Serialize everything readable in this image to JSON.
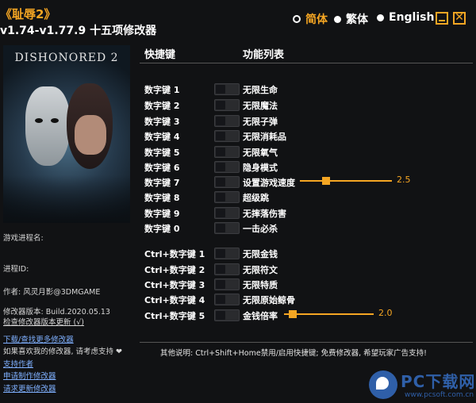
{
  "header": {
    "game_title": "《耻辱2》",
    "version_line": "v1.74-v1.77.9 十五项修改器"
  },
  "languages": [
    {
      "label": "简体",
      "selected": true
    },
    {
      "label": "繁体",
      "selected": false
    },
    {
      "label": "English",
      "selected": false
    }
  ],
  "window": {
    "minimize_icon": "minimize-icon",
    "close_icon": "close-icon",
    "close_glyph": "✕"
  },
  "cover": {
    "title": "DISHONORED 2"
  },
  "columns": {
    "hotkey": "快捷键",
    "function": "功能列表"
  },
  "hotkeys": [
    {
      "key": "数字键 1",
      "func": "无限生命"
    },
    {
      "key": "数字键 2",
      "func": "无限魔法"
    },
    {
      "key": "数字键 3",
      "func": "无限子弹"
    },
    {
      "key": "数字键 4",
      "func": "无限消耗品"
    },
    {
      "key": "数字键 5",
      "func": "无限氧气"
    },
    {
      "key": "数字键 6",
      "func": "隐身模式"
    },
    {
      "key": "数字键 7",
      "func": "设置游戏速度",
      "slider": 2.5
    },
    {
      "key": "数字键 8",
      "func": "超级跳"
    },
    {
      "key": "数字键 9",
      "func": "无摔落伤害"
    },
    {
      "key": "数字键 0",
      "func": "一击必杀"
    },
    {
      "key": "Ctrl+数字键 1",
      "func": "无限金钱"
    },
    {
      "key": "Ctrl+数字键 2",
      "func": "无限符文"
    },
    {
      "key": "Ctrl+数字键 3",
      "func": "无限特质"
    },
    {
      "key": "Ctrl+数字键 4",
      "func": "无限原始鲸骨"
    },
    {
      "key": "Ctrl+数字键 5",
      "func": "金钱倍率",
      "slider": 2.0
    }
  ],
  "slider_labels": {
    "speed": "2.5",
    "money": "2.0"
  },
  "info": {
    "process": "游戏进程名:",
    "process_id": "进程ID:",
    "author": "作者: 风灵月影@3DMGAME",
    "build": "修改器版本: Build.2020.05.13",
    "check_update": "检查修改器版本更新 (√)"
  },
  "links": {
    "download_more": "下载/查找更多修改器",
    "support_text": "如果喜欢我的修改器, 请考虑支持 ❤",
    "support_author": "支持作者",
    "request_trainer": "申请制作修改器",
    "request_update": "请求更新修改器"
  },
  "footer": {
    "note": "其他说明: Ctrl+Shift+Home禁用/启用快捷键; 免费修改器, 希望玩家广告支持!"
  },
  "watermark": {
    "brand": "PC下载网",
    "url": "www.pcsoft.com.cn"
  },
  "colors": {
    "accent": "#f5a623",
    "link": "#7fb0ff",
    "background": "#111214",
    "watermark": "#2f5fa8"
  }
}
